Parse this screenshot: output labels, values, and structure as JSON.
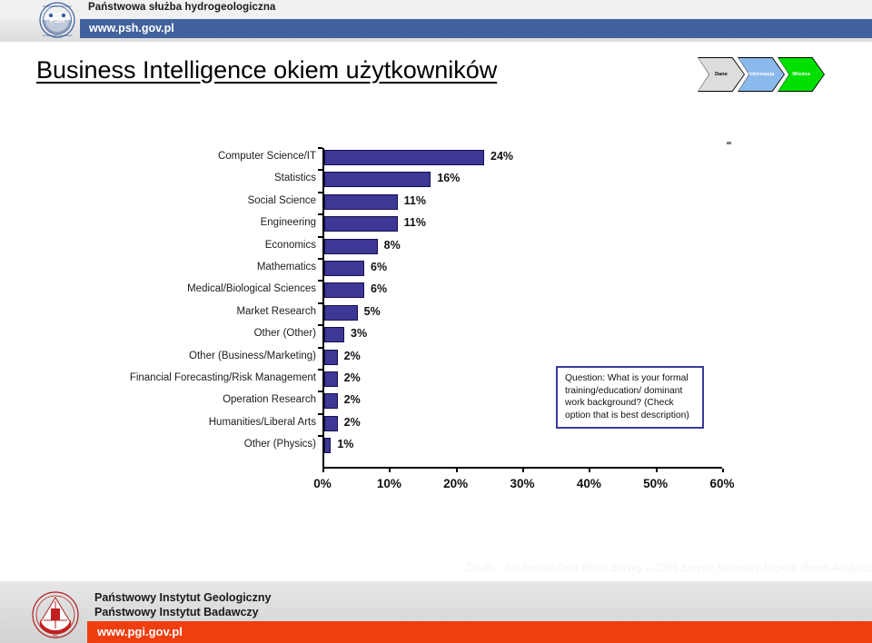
{
  "header": {
    "org_name": "Państwowa służba hydrogeologiczna",
    "url": "www.psh.gov.pl",
    "logo_text": "PSH"
  },
  "title": "Business Intelligence okiem użytkowników",
  "chevrons": [
    {
      "label": "Dane",
      "color": "#dddddd"
    },
    {
      "label": "Informacja",
      "color": "#8cb9ec"
    },
    {
      "label": "Wiedza",
      "color": "#00e000"
    }
  ],
  "question_box": {
    "text": "Question:  What is your formal training/education/ dominant work background? (Check option that is best description)"
  },
  "source_note": "Źródło : 3rd Annual Data Miner Survey – 2009 Survey Summary Report, Rexer Analytics, 2010",
  "footer": {
    "org_line1": "Państwowy Instytut Geologiczny",
    "org_line2": "Państwowy Instytut Badawczy",
    "url": "www.pgi.gov.pl",
    "logo_text": "PIG"
  },
  "chart_data": {
    "type": "bar",
    "orientation": "horizontal",
    "title": "",
    "xlabel": "",
    "ylabel": "",
    "xlim": [
      0,
      60
    ],
    "grid": false,
    "legend": "none",
    "bar_color": "#3d3795",
    "categories": [
      "Computer Science/IT",
      "Statistics",
      "Social Science",
      "Engineering",
      "Economics",
      "Mathematics",
      "Medical/Biological Sciences",
      "Market Research",
      "Other (Other)",
      "Other (Business/Marketing)",
      "Financial Forecasting/Risk Management",
      "Operation Research",
      "Humanities/Liberal Arts",
      "Other (Physics)"
    ],
    "values": [
      24,
      16,
      11,
      11,
      8,
      6,
      6,
      5,
      3,
      2,
      2,
      2,
      2,
      1
    ],
    "data_labels": [
      "24%",
      "16%",
      "11%",
      "11%",
      "8%",
      "6%",
      "6%",
      "5%",
      "3%",
      "2%",
      "2%",
      "2%",
      "2%",
      "1%"
    ],
    "x_ticks": [
      0,
      10,
      20,
      30,
      40,
      50,
      60
    ],
    "x_tick_labels": [
      "0%",
      "10%",
      "20%",
      "30%",
      "40%",
      "50%",
      "60%"
    ]
  }
}
